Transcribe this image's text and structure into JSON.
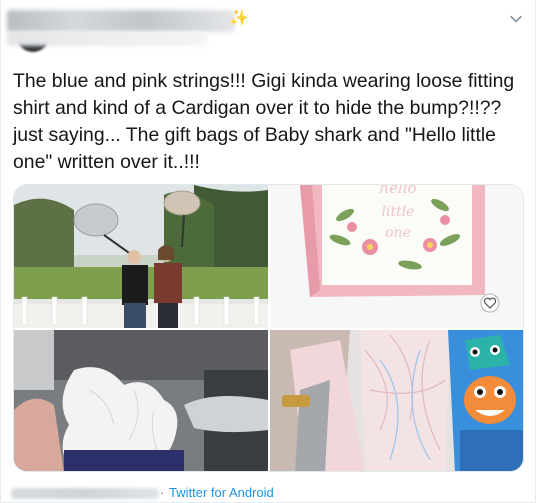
{
  "tweet": {
    "text": "The blue and pink strings!!! Gigi kinda wearing loose fitting shirt and kind of a Cardigan over it to hide the bump?!!??just saying... The gift bags of Baby shark and \"Hello little one\" written over it..!!!",
    "header_emoji": "✨",
    "gift_bag_lettering": [
      "hello",
      "little",
      "one"
    ]
  },
  "footer": {
    "separator": "·",
    "source_label": "Twitter for Android"
  },
  "icons": {
    "chevron": "chevron-down-icon",
    "heart": "heart-icon",
    "sparkle": "sparkle-icon"
  },
  "colors": {
    "link": "#1b95e0",
    "text": "#14171a",
    "muted": "#657786",
    "border": "#e1e8ed"
  }
}
